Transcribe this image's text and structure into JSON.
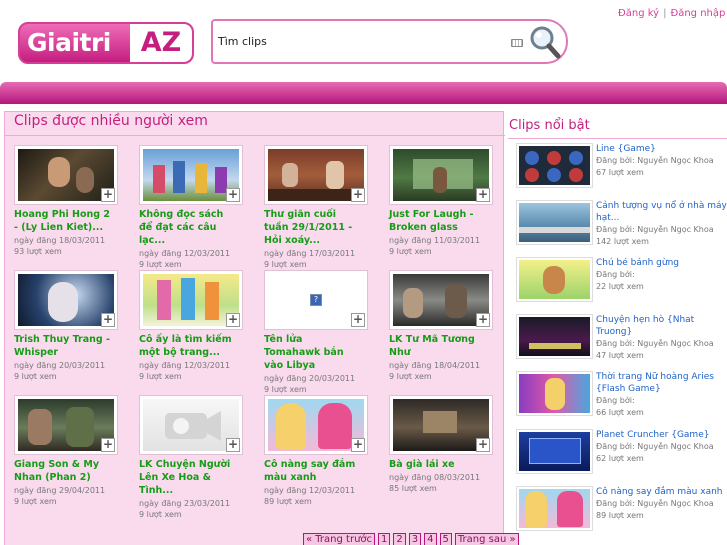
{
  "header": {
    "logo_part1": "Giaitri",
    "logo_part2": "AZ",
    "search_value": "Tìm clips",
    "register": "Đăng ký",
    "separator": "|",
    "login": "Đăng nhập"
  },
  "main": {
    "title": "Clips được nhiều người xem",
    "clips": [
      {
        "title": "Hoang Phi Hong 2 - (Ly Lien Kiet)...",
        "date": "ngày đăng 18/03/2011",
        "views": "93 lượt xem"
      },
      {
        "title": "Không đọc sách để đạt các câu lạc...",
        "date": "ngày đăng 12/03/2011",
        "views": "9 lượt xem"
      },
      {
        "title": "Thư giãn cuối tuần 29/1/2011 - Hỏi xoáy...",
        "date": "ngày đăng 17/03/2011",
        "views": "9 lượt xem"
      },
      {
        "title": "Just For Laugh - Broken glass",
        "date": "ngày đăng 11/03/2011",
        "views": "9 lượt xem"
      },
      {
        "title": "Trish Thuy Trang - Whisper",
        "date": "ngày đăng 20/03/2011",
        "views": "9 lượt xem"
      },
      {
        "title": "Cô ấy là tìm kiếm một bộ trang...",
        "date": "ngày đăng 12/03/2011",
        "views": "9 lượt xem"
      },
      {
        "title": "Tên lửa Tomahawk bắn vào Libya",
        "date": "ngày đăng 20/03/2011",
        "views": "9 lượt xem"
      },
      {
        "title": "LK Tư Mã Tương Như",
        "date": "ngày đăng 18/04/2011",
        "views": "9 lượt xem"
      },
      {
        "title": "Giang Son & My Nhan (Phan 2)",
        "date": "ngày đăng 29/04/2011",
        "views": "9 lượt xem"
      },
      {
        "title": "LK Chuyện Người Lên Xe Hoa & Tình...",
        "date": "ngày đăng 23/03/2011",
        "views": "9 lượt xem"
      },
      {
        "title": "Cô nàng say đắm màu xanh",
        "date": "ngày đăng 12/03/2011",
        "views": "89 lượt xem"
      },
      {
        "title": "Bà già lái xe",
        "date": "ngày đăng 08/03/2011",
        "views": "85 lượt xem"
      }
    ],
    "pagination": {
      "prev": "« Trang trước",
      "pages": [
        "1",
        "2",
        "3",
        "4",
        "5"
      ],
      "next": "Trang sau »"
    }
  },
  "sidebar": {
    "title": "Clips nổi bật",
    "items": [
      {
        "title": "Line {Game}",
        "meta1": "Đăng bởi: Nguyễn Ngọc Khoa",
        "meta2": "67 lượt xem"
      },
      {
        "title": "Cảnh tượng vụ nổ ở nhà máy hạt...",
        "meta1": "Đăng bởi: Nguyễn Ngọc Khoa",
        "meta2": "142 lượt xem"
      },
      {
        "title": "Chú bé bánh gừng",
        "meta1": "Đăng bởi:",
        "meta2": "22 lượt xem"
      },
      {
        "title": "Chuyện hẹn hò {Nhat Truong}",
        "meta1": "Đăng bởi: Nguyễn Ngọc Khoa",
        "meta2": "47 lượt xem"
      },
      {
        "title": "Thời trang Nữ hoàng Aries {Flash Game}",
        "meta1": "Đăng bởi:",
        "meta2": "66 lượt xem"
      },
      {
        "title": "Planet Cruncher {Game}",
        "meta1": "Đăng bởi: Nguyễn Ngọc Khoa",
        "meta2": "62 lượt xem"
      },
      {
        "title": "Cô nàng say đắm màu xanh",
        "meta1": "Đăng bởi: Nguyễn Ngọc Khoa",
        "meta2": "89 lượt xem"
      }
    ]
  },
  "colors": {
    "brand_pink": "#c41e7f",
    "panel_bg": "#fadbee",
    "clip_title_green": "#169c16",
    "link_blue": "#1f63c8"
  },
  "icons": [
    "search-icon",
    "keyboard-icon",
    "add-icon",
    "broken-image-icon",
    "video-camera-icon"
  ]
}
